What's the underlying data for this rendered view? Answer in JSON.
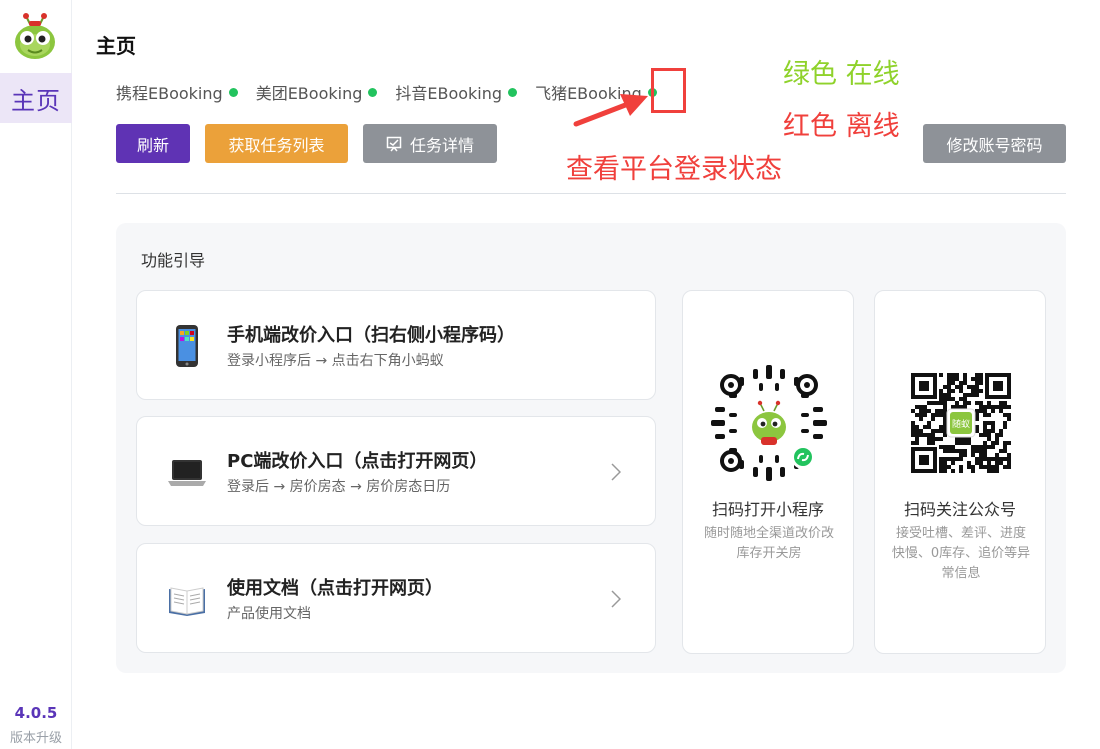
{
  "sidebar": {
    "logo_icon": "ant-mascot-icon",
    "nav_home": "主页",
    "version": "4.0.5",
    "upgrade": "版本升级"
  },
  "header": {
    "title": "主页",
    "platforms": [
      {
        "name": "携程EBooking",
        "status": "online"
      },
      {
        "name": "美团EBooking",
        "status": "online"
      },
      {
        "name": "抖音EBooking",
        "status": "online"
      },
      {
        "name": "飞猪EBooking",
        "status": "online"
      }
    ],
    "status_colors": {
      "online": "#22c35e",
      "offline": "#f0403c"
    }
  },
  "annotations": {
    "legend_online": "绿色 在线",
    "legend_offline": "红色 离线",
    "note": "查看平台登录状态"
  },
  "toolbar": {
    "refresh": "刷新",
    "get_tasks": "获取任务列表",
    "task_detail": "任务详情",
    "change_password": "修改账号密码"
  },
  "guide": {
    "title": "功能引导",
    "cards": [
      {
        "title": "手机端改价入口（扫右侧小程序码）",
        "subtitle": "登录小程序后 → 点击右下角小蚂蚁",
        "icon": "mobile-phone-icon"
      },
      {
        "title": "PC端改价入口（点击打开网页）",
        "subtitle": "登录后 → 房价房态 → 房价房态日历",
        "icon": "laptop-icon"
      },
      {
        "title": "使用文档（点击打开网页）",
        "subtitle": "产品使用文档",
        "icon": "open-book-icon"
      }
    ],
    "qr_cards": [
      {
        "title": "扫码打开小程序",
        "desc": "随时随地全渠道改价改库存开关房"
      },
      {
        "title": "扫码关注公众号",
        "desc": "接受吐槽、差评、进度快慢、0库存、追价等异常信息"
      }
    ],
    "qr_center_text": "随蚁"
  },
  "colors": {
    "primary": "#5f33b4",
    "orange": "#eba13a",
    "gray": "#8e9298"
  }
}
